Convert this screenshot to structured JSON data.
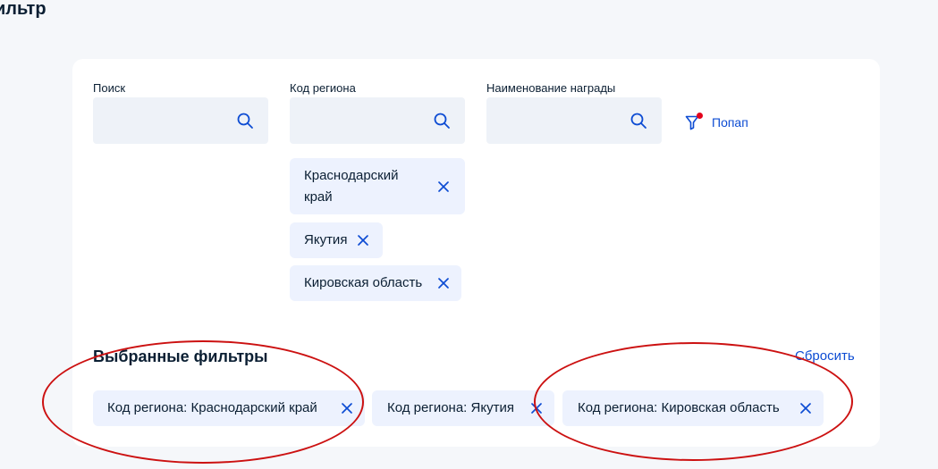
{
  "page": {
    "title": "ильтр"
  },
  "filters": {
    "search": {
      "label": "Поиск",
      "value": ""
    },
    "region_code": {
      "label": "Код региона",
      "value": ""
    },
    "award_name": {
      "label": "Наименование награды",
      "value": ""
    },
    "popup_label": "Попап"
  },
  "region_chips": [
    {
      "line1": "Краснодарский",
      "line2": "край"
    },
    {
      "label": "Якутия"
    },
    {
      "label": "Кировская область"
    }
  ],
  "selected": {
    "title": "Выбранные фильтры",
    "reset_label": "Сбросить",
    "chips": [
      "Код региона: Краснодарский край",
      "Код региона: Якутия",
      "Код региона: Кировская область"
    ]
  },
  "colors": {
    "accent": "#0d4cd3",
    "chip_bg": "#edf2fe",
    "input_bg": "#eef2f8",
    "notification_dot": "#e3001b",
    "annotation": "#cc1111"
  },
  "icons": {
    "search": "search-icon",
    "filter": "filter-icon",
    "close": "close-icon"
  }
}
